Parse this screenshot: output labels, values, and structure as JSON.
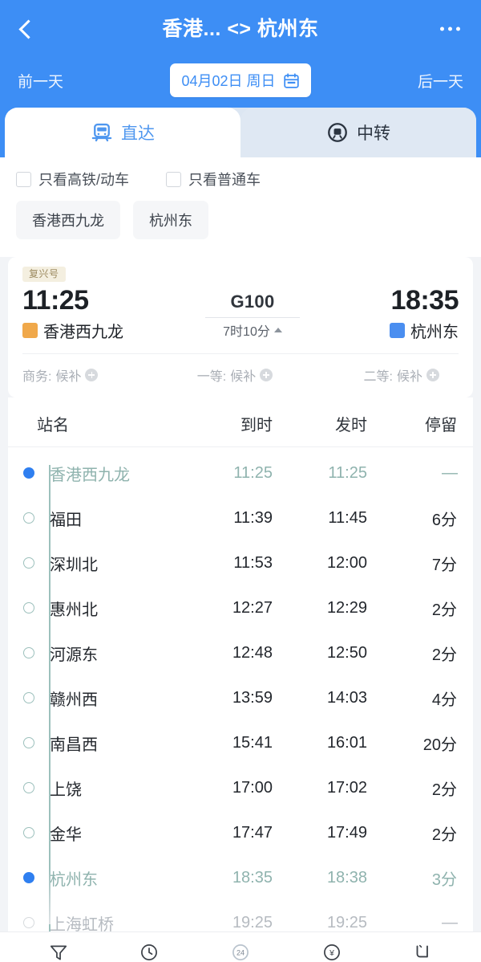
{
  "header": {
    "back_icon": "chevron-left-icon",
    "title": "香港... <> 杭州东",
    "more_icon": "more-horizontal-icon",
    "prev_day": "前一天",
    "next_day": "后一天",
    "date_text": "04月02日 周日",
    "calendar_icon": "calendar-icon",
    "bg_color": "#3d8ef5"
  },
  "tabs": [
    {
      "label": "直达",
      "icon": "train-front-icon",
      "active": true
    },
    {
      "label": "中转",
      "icon": "transfer-circle-icon",
      "active": false
    }
  ],
  "filters": {
    "checkboxes": [
      {
        "label": "只看高铁/动车",
        "checked": false
      },
      {
        "label": "只看普通车",
        "checked": false
      }
    ],
    "station_chips": [
      "香港西九龙",
      "杭州东"
    ]
  },
  "train": {
    "badge": "复兴号",
    "depart_time": "11:25",
    "depart_station": "香港西九龙",
    "depart_badge_color": "#f0a84a",
    "arrive_time": "18:35",
    "arrive_station": "杭州东",
    "arrive_badge_color": "#4a8ef0",
    "train_no": "G100",
    "duration": "7时10分",
    "expand_icon": "caret-up-icon",
    "seats": [
      {
        "label": "商务:",
        "status": "候补",
        "icon": "plus-circle-icon"
      },
      {
        "label": "一等:",
        "status": "候补",
        "icon": "plus-circle-icon"
      },
      {
        "label": "二等:",
        "status": "候补",
        "icon": "plus-circle-icon"
      }
    ]
  },
  "schedule": {
    "columns": [
      "站名",
      "到时",
      "发时",
      "停留"
    ],
    "rows": [
      {
        "station": "香港西九龙",
        "arrive": "11:25",
        "depart": "11:25",
        "stay": "—",
        "marker": "filled",
        "style": "hl"
      },
      {
        "station": "福田",
        "arrive": "11:39",
        "depart": "11:45",
        "stay": "6分",
        "marker": "hollow",
        "style": ""
      },
      {
        "station": "深圳北",
        "arrive": "11:53",
        "depart": "12:00",
        "stay": "7分",
        "marker": "hollow",
        "style": ""
      },
      {
        "station": "惠州北",
        "arrive": "12:27",
        "depart": "12:29",
        "stay": "2分",
        "marker": "hollow",
        "style": ""
      },
      {
        "station": "河源东",
        "arrive": "12:48",
        "depart": "12:50",
        "stay": "2分",
        "marker": "hollow",
        "style": ""
      },
      {
        "station": "赣州西",
        "arrive": "13:59",
        "depart": "14:03",
        "stay": "4分",
        "marker": "hollow",
        "style": ""
      },
      {
        "station": "南昌西",
        "arrive": "15:41",
        "depart": "16:01",
        "stay": "20分",
        "marker": "hollow",
        "style": ""
      },
      {
        "station": "上饶",
        "arrive": "17:00",
        "depart": "17:02",
        "stay": "2分",
        "marker": "hollow",
        "style": ""
      },
      {
        "station": "金华",
        "arrive": "17:47",
        "depart": "17:49",
        "stay": "2分",
        "marker": "hollow",
        "style": ""
      },
      {
        "station": "杭州东",
        "arrive": "18:35",
        "depart": "18:38",
        "stay": "3分",
        "marker": "filled",
        "style": "hl"
      },
      {
        "station": "上海虹桥",
        "arrive": "19:25",
        "depart": "19:25",
        "stay": "—",
        "marker": "hollow-faded",
        "style": "dim"
      }
    ]
  },
  "bottom_bar": [
    {
      "icon": "filter-funnel-icon"
    },
    {
      "icon": "clock-history-icon"
    },
    {
      "icon": "24h-circle-icon"
    },
    {
      "icon": "yen-circle-icon"
    },
    {
      "icon": "seat-icon"
    }
  ]
}
